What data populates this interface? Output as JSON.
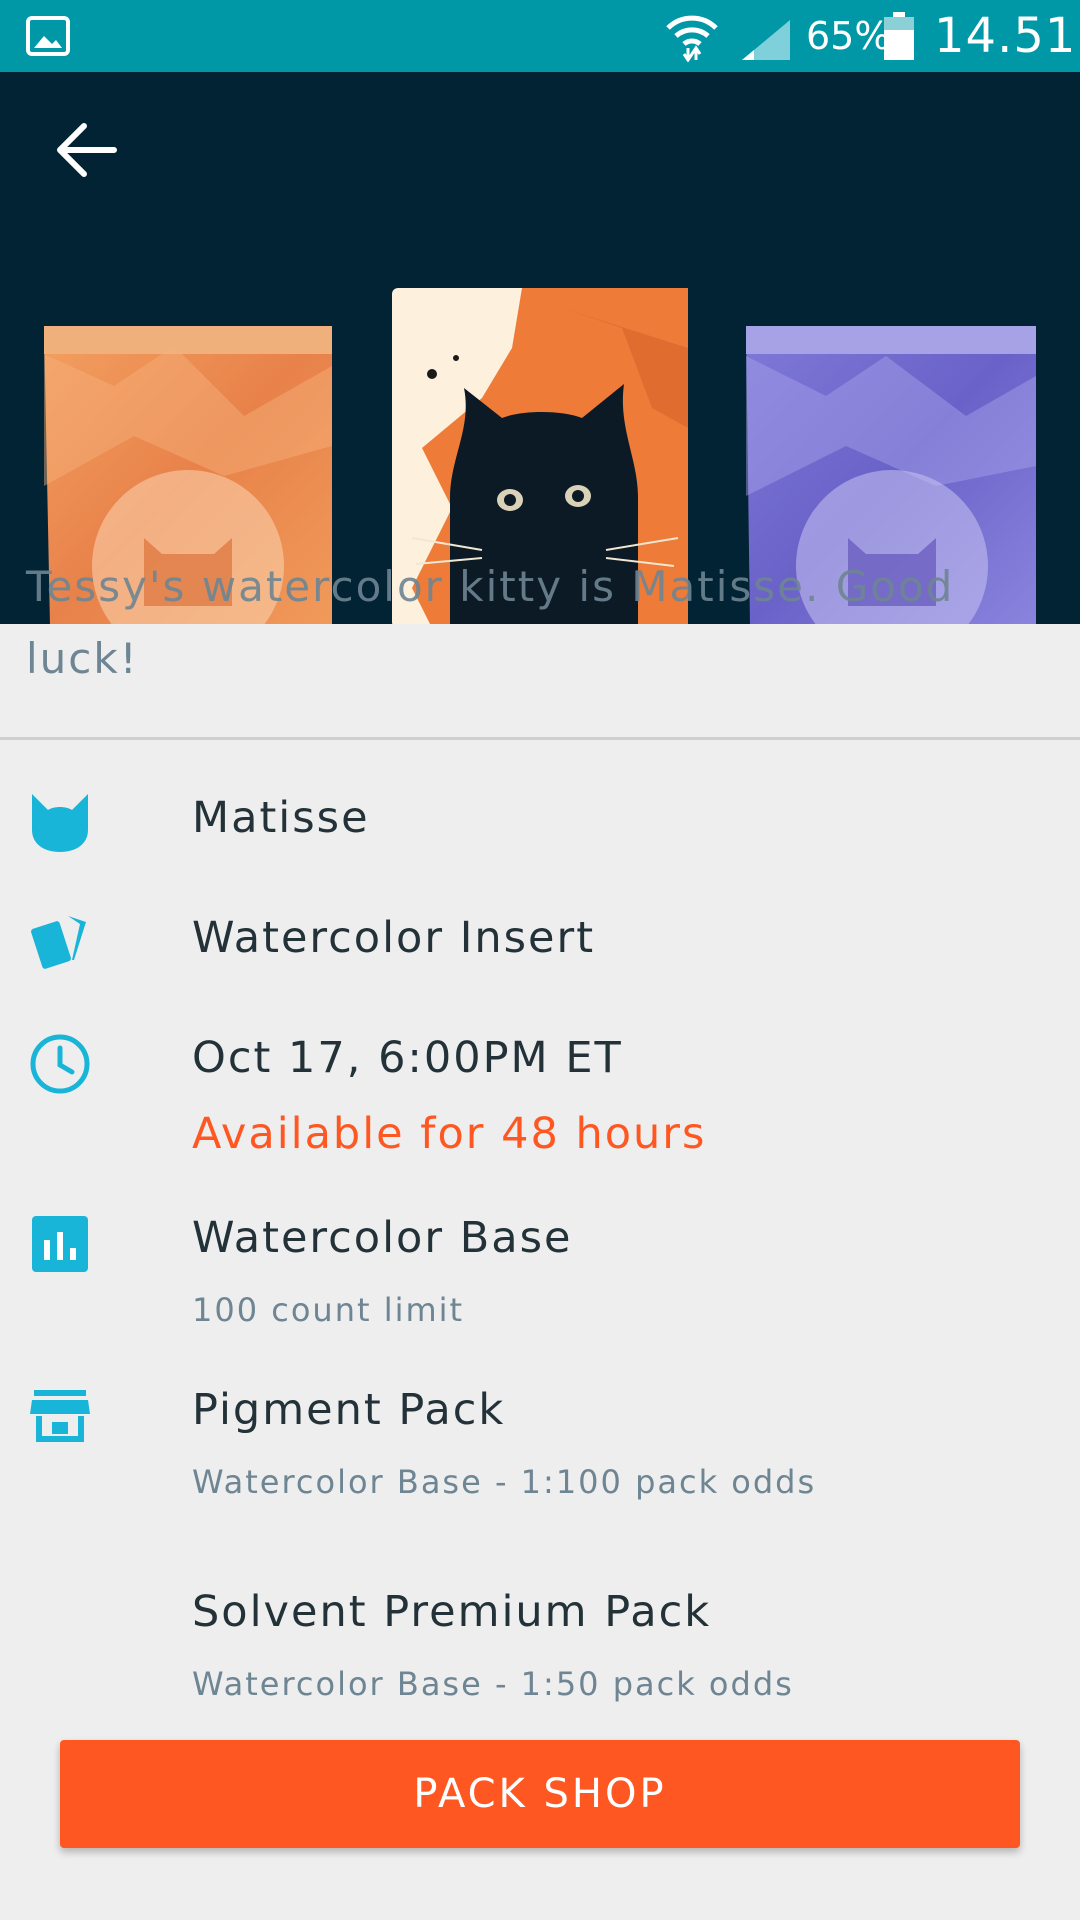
{
  "status_bar": {
    "battery_percent": "65%",
    "time": "14.51"
  },
  "description": {
    "partial_line": "Tessy's watercolor kitty is Matisse. Good",
    "last_line": "luck!"
  },
  "details": {
    "artist": "Matisse",
    "set": "Watercolor Insert",
    "release": "Oct 17, 6:00PM ET",
    "availability": "Available for 48 hours",
    "base": {
      "title": "Watercolor Base",
      "sub": "100 count limit"
    },
    "packs": [
      {
        "title": "Pigment Pack",
        "sub": "Watercolor Base - 1:100 pack odds"
      },
      {
        "title": "Solvent Premium Pack",
        "sub": "Watercolor Base - 1:50 pack odds"
      }
    ]
  },
  "actions": {
    "pack_shop_label": "PACK SHOP"
  },
  "colors": {
    "status_bar": "#0097a7",
    "header_bg": "#022334",
    "accent_icon": "#19b5d8",
    "alert": "#ff5722",
    "button": "#ff5722"
  }
}
